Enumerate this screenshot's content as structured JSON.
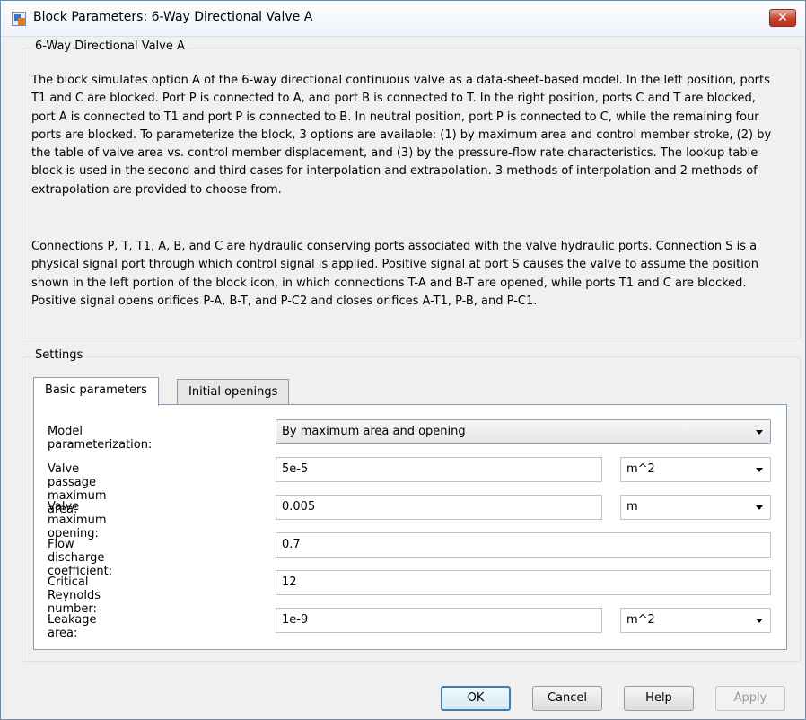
{
  "window": {
    "title": "Block Parameters: 6-Way Directional Valve A",
    "close_label": "✕"
  },
  "description": {
    "group_label": "6-Way Directional Valve A",
    "paragraph1": "The block simulates option A of the 6-way directional continuous valve as a data-sheet-based model. In the left position, ports T1 and C are blocked. Port P is connected to A, and port B is connected to T. In the right position, ports C and T are blocked, port A is connected to T1 and port P is connected to B. In neutral position, port P is connected to C, while the remaining four ports are blocked. To parameterize the block, 3 options are available: (1) by maximum area and control member stroke, (2) by the table of valve area vs. control member displacement, and (3) by the pressure-flow rate characteristics. The lookup table block is used in the second and third cases for interpolation and extrapolation. 3 methods of interpolation and 2 methods of extrapolation are provided to choose from.",
    "paragraph2": "Connections P, T, T1, A, B, and C are hydraulic conserving ports associated with the valve hydraulic ports. Connection S is a physical signal port through which control signal is applied. Positive signal at port S causes the valve to assume the position shown in the left portion of the block icon, in which connections T-A and B-T are opened, while ports T1 and C are blocked. Positive signal opens orifices P-A, B-T, and P-C2 and closes orifices A-T1, P-B, and P-C1."
  },
  "settings": {
    "group_label": "Settings",
    "tabs": [
      {
        "label": "Basic parameters",
        "active": true
      },
      {
        "label": "Initial openings",
        "active": false
      }
    ],
    "fields": {
      "model_param": {
        "label": "Model parameterization:",
        "value": "By maximum area and opening"
      },
      "max_area": {
        "label": "Valve passage maximum area:",
        "value": "5e-5",
        "unit": "m^2"
      },
      "max_opening": {
        "label": "Valve maximum opening:",
        "value": "0.005",
        "unit": "m"
      },
      "discharge": {
        "label": "Flow discharge coefficient:",
        "value": "0.7"
      },
      "reynolds": {
        "label": "Critical Reynolds number:",
        "value": "12"
      },
      "leakage": {
        "label": "Leakage area:",
        "value": "1e-9",
        "unit": "m^2"
      }
    }
  },
  "buttons": {
    "ok": "OK",
    "cancel": "Cancel",
    "help": "Help",
    "apply": "Apply"
  }
}
